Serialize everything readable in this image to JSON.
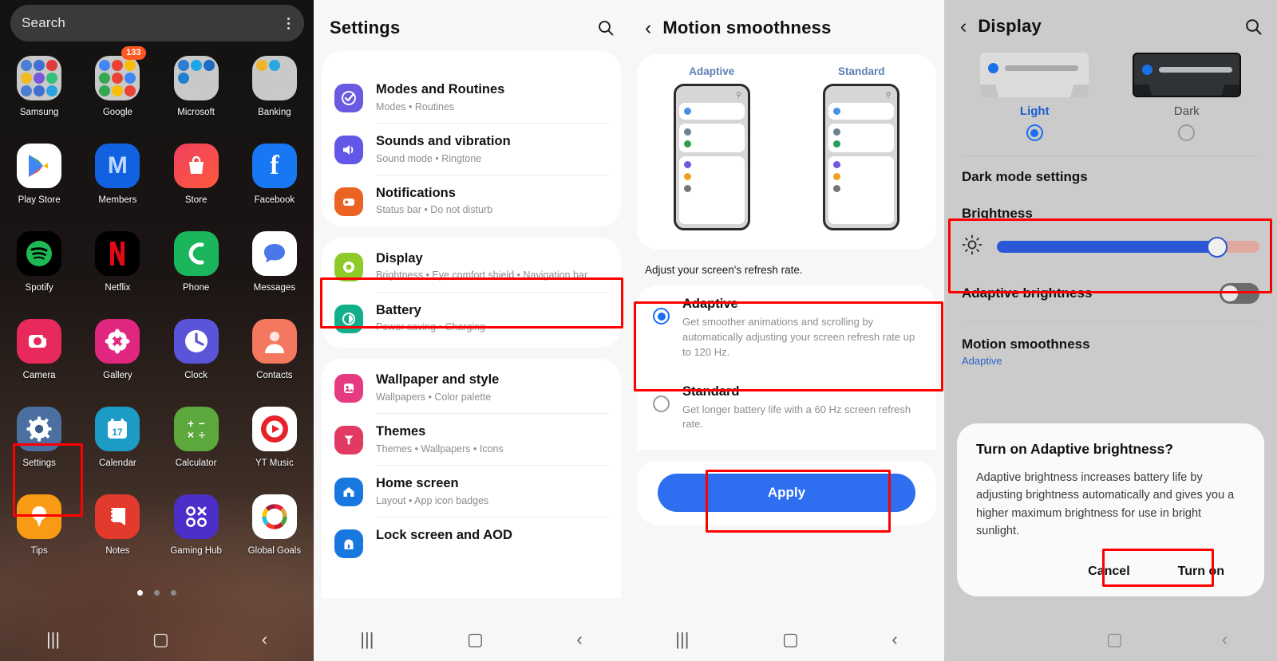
{
  "panel1": {
    "search": {
      "placeholder": "Search",
      "menu_icon": "kebab-menu-icon"
    },
    "apps": [
      [
        {
          "label": "Samsung",
          "type": "folder",
          "badge": null,
          "colors": [
            "#4a7fd4",
            "#3f6fd0",
            "#e03a3a",
            "#f1b81f",
            "#7a59d8",
            "#33c07a",
            "#4a7fd4",
            "#3f6fd0",
            "#2aa3e0"
          ]
        },
        {
          "label": "Google",
          "type": "folder",
          "badge": "133",
          "colors": [
            "#4285f4",
            "#ea4335",
            "#fbbc05",
            "#34a853",
            "#ea4335",
            "#4285f4",
            "#34a853",
            "#fbbc05",
            "#ea4335"
          ]
        },
        {
          "label": "Microsoft",
          "type": "folder",
          "badge": null,
          "colors": [
            "#2b7cd3",
            "#21a4e6",
            "#1b6cc4",
            "#1f7fd0",
            "#c9c9c9",
            "#c9c9c9",
            "#c9c9c9",
            "#c9c9c9",
            "#c9c9c9"
          ]
        },
        {
          "label": "Banking",
          "type": "folder",
          "badge": null,
          "colors": [
            "#f0b429",
            "#29a8e0",
            "#c9c9c9",
            "#c9c9c9",
            "#c9c9c9",
            "#c9c9c9",
            "#c9c9c9",
            "#c9c9c9",
            "#c9c9c9"
          ]
        }
      ],
      [
        {
          "label": "Play Store",
          "type": "app",
          "icon": "play-store-icon",
          "bg": "#ffffff"
        },
        {
          "label": "Members",
          "type": "app",
          "icon": "samsung-members-icon",
          "bg": "#1161e0"
        },
        {
          "label": "Store",
          "type": "app",
          "icon": "galaxy-store-icon",
          "bg": "linear-gradient(140deg,#f04060,#ff5a3c)"
        },
        {
          "label": "Facebook",
          "type": "app",
          "icon": "facebook-icon",
          "bg": "#1877f2"
        }
      ],
      [
        {
          "label": "Spotify",
          "type": "app",
          "icon": "spotify-icon",
          "bg": "#000000"
        },
        {
          "label": "Netflix",
          "type": "app",
          "icon": "netflix-icon",
          "bg": "#000000"
        },
        {
          "label": "Phone",
          "type": "app",
          "icon": "phone-icon",
          "bg": "#1bb55c"
        },
        {
          "label": "Messages",
          "type": "app",
          "icon": "messages-icon",
          "bg": "#ffffff"
        }
      ],
      [
        {
          "label": "Camera",
          "type": "app",
          "icon": "camera-icon",
          "bg": "#e8295b"
        },
        {
          "label": "Gallery",
          "type": "app",
          "icon": "gallery-icon",
          "bg": "#e0267f"
        },
        {
          "label": "Clock",
          "type": "app",
          "icon": "clock-icon",
          "bg": "#5a54d8"
        },
        {
          "label": "Contacts",
          "type": "app",
          "icon": "contacts-icon",
          "bg": "#f4775f"
        }
      ],
      [
        {
          "label": "Settings",
          "type": "app",
          "icon": "gear-icon",
          "bg": "#4a6fa0"
        },
        {
          "label": "Calendar",
          "type": "app",
          "icon": "calendar-icon",
          "bg": "#1c9bc4",
          "day": "17"
        },
        {
          "label": "Calculator",
          "type": "app",
          "icon": "calculator-icon",
          "bg": "#5ca83c"
        },
        {
          "label": "YT Music",
          "type": "app",
          "icon": "yt-music-icon",
          "bg": "#ffffff"
        }
      ],
      [
        {
          "label": "Tips",
          "type": "app",
          "icon": "tips-bulb-icon",
          "bg": "#f99a14"
        },
        {
          "label": "Notes",
          "type": "app",
          "icon": "notes-icon",
          "bg": "#e23b2e"
        },
        {
          "label": "Gaming Hub",
          "type": "app",
          "icon": "gaming-hub-icon",
          "bg": "#4c2fc9"
        },
        {
          "label": "Global Goals",
          "type": "app",
          "icon": "global-goals-icon",
          "bg": "#ffffff"
        }
      ]
    ],
    "page_dots": {
      "count": 3,
      "active_index": 0
    },
    "nav": {
      "recents": "|||",
      "home": "▢",
      "back": "‹"
    },
    "highlight": {
      "target": "settings-app-icon"
    }
  },
  "panel2": {
    "title": "Settings",
    "search_icon": "search-icon",
    "items": [
      {
        "title": "Modes and Routines",
        "sub": "Modes  •  Routines",
        "icon": "modes-routines-icon",
        "color": "#6a5ae0"
      },
      {
        "title": "Sounds and vibration",
        "sub": "Sound mode  •  Ringtone",
        "icon": "sound-icon",
        "color": "#6257e8"
      },
      {
        "title": "Notifications",
        "sub": "Status bar  •  Do not disturb",
        "icon": "notifications-icon",
        "color": "#ea6322"
      },
      {
        "title": "Display",
        "sub": "Brightness  •  Eye comfort shield  •  Navigation bar",
        "icon": "display-icon",
        "color": "#8ecb28",
        "highlighted": true
      },
      {
        "title": "Battery",
        "sub": "Power saving  •  Charging",
        "icon": "battery-icon",
        "color": "#12b08a"
      },
      {
        "title": "Wallpaper and style",
        "sub": "Wallpapers  •  Color palette",
        "icon": "wallpaper-icon",
        "color": "#e63b80"
      },
      {
        "title": "Themes",
        "sub": "Themes  •  Wallpapers  •  Icons",
        "icon": "themes-icon",
        "color": "#e23a63"
      },
      {
        "title": "Home screen",
        "sub": "Layout  •  App icon badges",
        "icon": "home-screen-icon",
        "color": "#1878e0"
      },
      {
        "title": "Lock screen and AOD",
        "sub": "",
        "icon": "lock-screen-icon",
        "color": "#1878e0"
      }
    ],
    "nav": {
      "recents": "|||",
      "home": "▢",
      "back": "‹"
    }
  },
  "panel3": {
    "back_icon": "back-chevron-icon",
    "title": "Motion smoothness",
    "preview": {
      "left_caption": "Adaptive",
      "right_caption": "Standard",
      "dot_colors": [
        "#4a90e2",
        "#6b8290",
        "#2e9e52",
        "#6a5ae0",
        "#f0a124",
        "#777777"
      ]
    },
    "hint": "Adjust your screen's refresh rate.",
    "options": [
      {
        "title": "Adaptive",
        "desc": "Get smoother animations and scrolling by automatically adjusting your screen refresh rate up to 120 Hz.",
        "selected": true,
        "highlighted": true
      },
      {
        "title": "Standard",
        "desc": "Get longer battery life with a 60 Hz screen refresh rate.",
        "selected": false,
        "highlighted": false
      }
    ],
    "apply_label": "Apply",
    "nav": {
      "recents": "|||",
      "home": "▢",
      "back": "‹"
    }
  },
  "panel4": {
    "back_icon": "back-chevron-icon",
    "title": "Display",
    "search_icon": "search-icon",
    "theme_modes": [
      {
        "label": "Light",
        "selected": true
      },
      {
        "label": "Dark",
        "selected": false
      }
    ],
    "dark_mode_settings_label": "Dark mode settings",
    "brightness": {
      "label": "Brightness",
      "icon": "brightness-sun-icon",
      "value_percent": 84
    },
    "adaptive_brightness": {
      "label": "Adaptive brightness",
      "enabled": false
    },
    "motion_smoothness": {
      "label": "Motion smoothness",
      "value": "Adaptive"
    },
    "dialog": {
      "title": "Turn on Adaptive brightness?",
      "body": "Adaptive brightness increases battery life by adjusting brightness automatically and gives you a higher maximum brightness for use in bright sunlight.",
      "cancel_label": "Cancel",
      "confirm_label": "Turn on"
    },
    "nav": {
      "home": "▢",
      "back": "‹"
    }
  },
  "accent": {
    "blue": "#2e6ff2",
    "highlight_red": "#ff0000"
  }
}
